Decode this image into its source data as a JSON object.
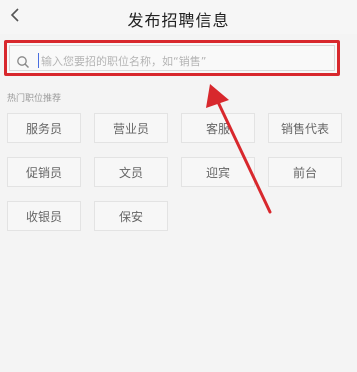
{
  "header": {
    "title": "发布招聘信息",
    "back_icon": "chevron-left-icon"
  },
  "search": {
    "placeholder": "输入您要招的职位名称，如“销售”",
    "icon": "search-icon",
    "highlight_color": "#d8282d"
  },
  "section": {
    "label": "热门职位推荐"
  },
  "tags": [
    "服务员",
    "营业员",
    "客服",
    "销售代表",
    "促销员",
    "文员",
    "迎宾",
    "前台",
    "收银员",
    "保安"
  ],
  "annotation": {
    "arrow_color": "#d8282d"
  }
}
